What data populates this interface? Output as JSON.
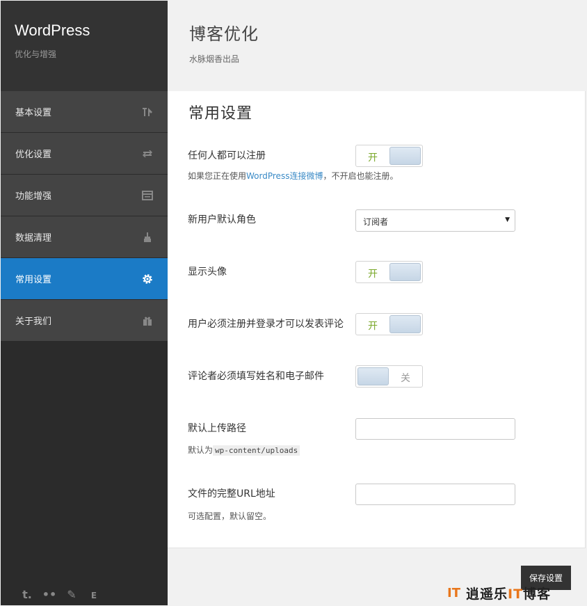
{
  "brand": {
    "title": "WordPress",
    "subtitle": "优化与增强"
  },
  "header": {
    "title": "博客优化",
    "subtitle": "水脉烟香出品"
  },
  "menu": [
    {
      "label": "基本设置",
      "icon": "tools-icon",
      "active": false
    },
    {
      "label": "优化设置",
      "icon": "refresh-icon",
      "active": false
    },
    {
      "label": "功能增强",
      "icon": "window-icon",
      "active": false
    },
    {
      "label": "数据清理",
      "icon": "broom-icon",
      "active": false
    },
    {
      "label": "常用设置",
      "icon": "gear-icon",
      "active": true
    },
    {
      "label": "关于我们",
      "icon": "gift-icon",
      "active": false
    }
  ],
  "social": [
    "t.",
    "••",
    "✎",
    "ᴇ"
  ],
  "section": {
    "title": "常用设置"
  },
  "settings": {
    "register": {
      "label": "任何人都可以注册",
      "state": "开",
      "help_prefix": "如果您正在使用",
      "help_link": "WordPress连接微博",
      "help_suffix": "，不开启也能注册。"
    },
    "role": {
      "label": "新用户默认角色",
      "value": "订阅者"
    },
    "avatar": {
      "label": "显示头像",
      "state": "开"
    },
    "login_comment": {
      "label": "用户必须注册并登录才可以发表评论",
      "state": "开"
    },
    "name_email": {
      "label": "评论者必须填写姓名和电子邮件",
      "state": "关"
    },
    "upload_path": {
      "label": "默认上传路径",
      "help_prefix": "默认为",
      "help_code": "wp-content/uploads",
      "value": ""
    },
    "upload_url": {
      "label": "文件的完整URL地址",
      "help": "可选配置，默认留空。",
      "value": ""
    }
  },
  "save_label": "保存设置",
  "watermark": {
    "logo": "IT",
    "text_a": "逍遥乐",
    "text_b": "IT",
    "text_c": "博客"
  },
  "colors": {
    "accent": "#1b7bc6",
    "toggle_on": "#7aa82a",
    "link": "#3a8ac6"
  }
}
